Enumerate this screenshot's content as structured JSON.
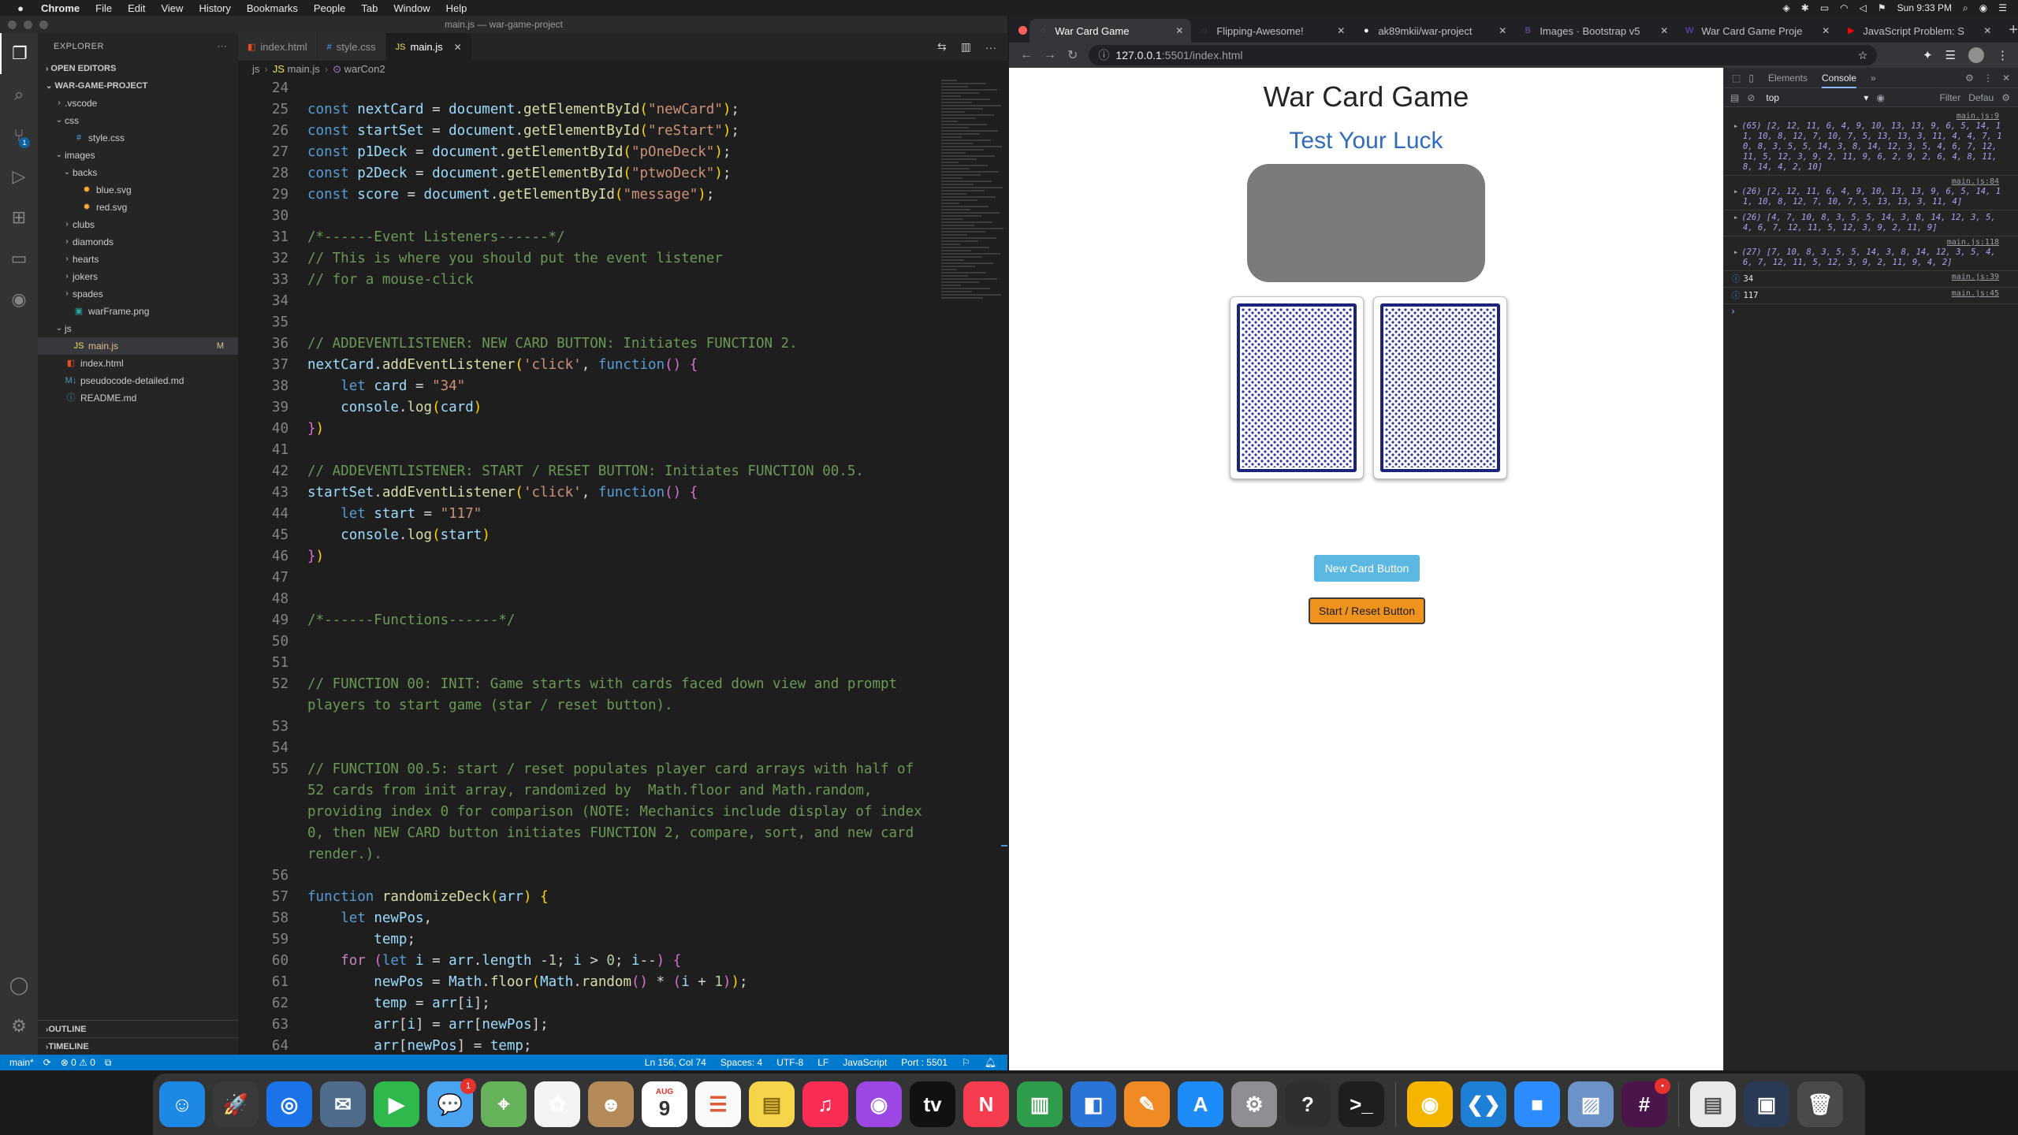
{
  "menubar": {
    "app": "Chrome",
    "items": [
      "File",
      "Edit",
      "View",
      "History",
      "Bookmarks",
      "People",
      "Tab",
      "Window",
      "Help"
    ],
    "clock": "Sun 9:33 PM"
  },
  "vscode": {
    "window_title": "main.js — war-game-project",
    "explorer": {
      "title": "EXPLORER",
      "open_editors": "OPEN EDITORS",
      "project": "WAR-GAME-PROJECT",
      "tree": [
        {
          "name": ".vscode",
          "type": "folder",
          "depth": 1,
          "open": false
        },
        {
          "name": "css",
          "type": "folder",
          "depth": 1,
          "open": true
        },
        {
          "name": "style.css",
          "type": "css",
          "depth": 2
        },
        {
          "name": "images",
          "type": "folder",
          "depth": 1,
          "open": true
        },
        {
          "name": "backs",
          "type": "folder",
          "depth": 2,
          "open": true
        },
        {
          "name": "blue.svg",
          "type": "svg",
          "depth": 3
        },
        {
          "name": "red.svg",
          "type": "svg",
          "depth": 3
        },
        {
          "name": "clubs",
          "type": "folder",
          "depth": 2,
          "open": false
        },
        {
          "name": "diamonds",
          "type": "folder",
          "depth": 2,
          "open": false
        },
        {
          "name": "hearts",
          "type": "folder",
          "depth": 2,
          "open": false
        },
        {
          "name": "jokers",
          "type": "folder",
          "depth": 2,
          "open": false
        },
        {
          "name": "spades",
          "type": "folder",
          "depth": 2,
          "open": false
        },
        {
          "name": "warFrame.png",
          "type": "png",
          "depth": 2
        },
        {
          "name": "js",
          "type": "folder",
          "depth": 1,
          "open": true
        },
        {
          "name": "main.js",
          "type": "js",
          "depth": 2,
          "selected": true,
          "modified": "M"
        },
        {
          "name": "index.html",
          "type": "html",
          "depth": 1
        },
        {
          "name": "pseudocode-detailed.md",
          "type": "md",
          "depth": 1
        },
        {
          "name": "README.md",
          "type": "info",
          "depth": 1
        }
      ],
      "outline": "OUTLINE",
      "timeline": "TIMELINE"
    },
    "tabs": [
      {
        "label": "index.html",
        "icon": "html-icon",
        "active": false
      },
      {
        "label": "style.css",
        "icon": "css-icon",
        "active": false
      },
      {
        "label": "main.js",
        "icon": "js-icon",
        "active": true
      }
    ],
    "breadcrumb": [
      "js",
      "main.js",
      "warCon2"
    ],
    "code_lines": [
      {
        "n": "24",
        "html": ""
      },
      {
        "n": "25",
        "html": "<span class='kw'>const</span> <span class='var'>nextCard</span> = <span class='var'>document</span>.<span class='fn'>getElementById</span><span class='brk'>(</span><span class='str'>\"newCard\"</span><span class='brk'>)</span>;"
      },
      {
        "n": "26",
        "html": "<span class='kw'>const</span> <span class='var'>startSet</span> = <span class='var'>document</span>.<span class='fn'>getElementById</span><span class='brk'>(</span><span class='str'>\"reStart\"</span><span class='brk'>)</span>;"
      },
      {
        "n": "27",
        "html": "<span class='kw'>const</span> <span class='var'>p1Deck</span> = <span class='var'>document</span>.<span class='fn'>getElementById</span><span class='brk'>(</span><span class='str'>\"pOneDeck\"</span><span class='brk'>)</span>;"
      },
      {
        "n": "28",
        "html": "<span class='kw'>const</span> <span class='var'>p2Deck</span> = <span class='var'>document</span>.<span class='fn'>getElementById</span><span class='brk'>(</span><span class='str'>\"ptwoDeck\"</span><span class='brk'>)</span>;"
      },
      {
        "n": "29",
        "html": "<span class='kw'>const</span> <span class='var'>score</span> = <span class='var'>document</span>.<span class='fn'>getElementById</span><span class='brk'>(</span><span class='str'>\"message\"</span><span class='brk'>)</span>;"
      },
      {
        "n": "30",
        "html": ""
      },
      {
        "n": "31",
        "html": "<span class='cmt'>/*------Event Listeners------*/</span>"
      },
      {
        "n": "32",
        "html": "<span class='cmt'>// This is where you should put the event listener</span>"
      },
      {
        "n": "33",
        "html": "<span class='cmt'>// for a mouse-click</span>"
      },
      {
        "n": "34",
        "html": ""
      },
      {
        "n": "35",
        "html": ""
      },
      {
        "n": "36",
        "html": "<span class='cmt'>// ADDEVENTLISTENER: NEW CARD BUTTON: Initiates FUNCTION 2.</span>"
      },
      {
        "n": "37",
        "html": "<span class='var'>nextCard</span>.<span class='fn'>addEventListener</span><span class='brk'>(</span><span class='str'>'click'</span>, <span class='kw'>function</span><span class='brk2'>()</span> <span class='brk2'>{</span>"
      },
      {
        "n": "38",
        "html": "    <span class='kw'>let</span> <span class='var'>card</span> = <span class='str'>\"34\"</span>"
      },
      {
        "n": "39",
        "html": "    <span class='var'>console</span>.<span class='fn'>log</span><span class='brk'>(</span><span class='var'>card</span><span class='brk'>)</span>"
      },
      {
        "n": "40",
        "html": "<span class='brk2'>}</span><span class='brk'>)</span>"
      },
      {
        "n": "41",
        "html": ""
      },
      {
        "n": "42",
        "html": "<span class='cmt'>// ADDEVENTLISTENER: START / RESET BUTTON: Initiates FUNCTION 00.5.</span>"
      },
      {
        "n": "43",
        "html": "<span class='var'>startSet</span>.<span class='fn'>addEventListener</span><span class='brk'>(</span><span class='str'>'click'</span>, <span class='kw'>function</span><span class='brk2'>()</span> <span class='brk2'>{</span>"
      },
      {
        "n": "44",
        "html": "    <span class='kw'>let</span> <span class='var'>start</span> = <span class='str'>\"117\"</span>"
      },
      {
        "n": "45",
        "html": "    <span class='var'>console</span>.<span class='fn'>log</span><span class='brk'>(</span><span class='var'>start</span><span class='brk'>)</span>"
      },
      {
        "n": "46",
        "html": "<span class='brk2'>}</span><span class='brk'>)</span>"
      },
      {
        "n": "47",
        "html": ""
      },
      {
        "n": "48",
        "html": ""
      },
      {
        "n": "49",
        "html": "<span class='cmt'>/*------Functions------*/</span>"
      },
      {
        "n": "50",
        "html": ""
      },
      {
        "n": "51",
        "html": ""
      },
      {
        "n": "52",
        "html": "<span class='cmt'>// FUNCTION 00: INIT: Game starts with cards faced down view and prompt players to start game (star / reset button).</span>",
        "wrap": 2
      },
      {
        "n": "53",
        "html": ""
      },
      {
        "n": "54",
        "html": ""
      },
      {
        "n": "55",
        "html": "<span class='cmt'>// FUNCTION 00.5: start / reset populates player card arrays with half of 52 cards from init array, randomized by  Math.floor and Math.random, providing index 0 for comparison (NOTE: Mechanics include display of index 0, then NEW CARD button initiates FUNCTION 2, compare, sort, and new card render.).</span>",
        "wrap": 5
      },
      {
        "n": "56",
        "html": ""
      },
      {
        "n": "57",
        "html": "<span class='kw'>function</span> <span class='fn'>randomizeDeck</span><span class='brk'>(</span><span class='var'>arr</span><span class='brk'>)</span> <span class='brk'>{</span>"
      },
      {
        "n": "58",
        "html": "    <span class='kw'>let</span> <span class='var'>newPos</span>,"
      },
      {
        "n": "59",
        "html": "        <span class='var'>temp</span>;"
      },
      {
        "n": "60",
        "html": "    <span class='kw2'>for</span> <span class='brk2'>(</span><span class='kw'>let</span> <span class='var'>i</span> = <span class='var'>arr</span>.<span class='var'>length</span> -<span class='num'>1</span>; <span class='var'>i</span> &gt; <span class='num'>0</span>; <span class='var'>i</span>--<span class='brk2'>)</span> <span class='brk2'>{</span>"
      },
      {
        "n": "61",
        "html": "        <span class='var'>newPos</span> = <span class='var'>Math</span>.<span class='fn'>floor</span><span class='brk'>(</span><span class='var'>Math</span>.<span class='fn'>random</span><span class='brk2'>()</span> * <span class='brk2'>(</span><span class='var'>i</span> + <span class='num'>1</span><span class='brk2'>)</span><span class='brk'>)</span>;"
      },
      {
        "n": "62",
        "html": "        <span class='var'>temp</span> = <span class='var'>arr</span>[<span class='var'>i</span>];"
      },
      {
        "n": "63",
        "html": "        <span class='var'>arr</span>[<span class='var'>i</span>] = <span class='var'>arr</span>[<span class='var'>newPos</span>];"
      },
      {
        "n": "64",
        "html": "        <span class='var'>arr</span>[<span class='var'>newPos</span>] = <span class='var'>temp</span>;"
      }
    ],
    "statusbar": {
      "branch": "main*",
      "problems": "⊗ 0 ⚠ 0",
      "position": "Ln 156, Col 74",
      "spaces": "Spaces: 4",
      "encoding": "UTF-8",
      "eol": "LF",
      "language": "JavaScript",
      "port": "Port : 5501"
    }
  },
  "chrome": {
    "tabs": [
      {
        "label": "War Card Game",
        "active": true,
        "favicon": "globe-icon",
        "color": "#5f6368"
      },
      {
        "label": "Flipping-Awesome!",
        "active": false,
        "favicon": "globe-icon",
        "color": "#5f6368"
      },
      {
        "label": "ak89mkii/war-project",
        "active": false,
        "favicon": "github-icon",
        "color": "#ffffff"
      },
      {
        "label": "Images · Bootstrap v5",
        "active": false,
        "favicon": "bootstrap-icon",
        "color": "#7952b3"
      },
      {
        "label": "War Card Game Proje",
        "active": false,
        "favicon": "w-icon",
        "color": "#6b4bd6"
      },
      {
        "label": "JavaScript Problem: S",
        "active": false,
        "favicon": "youtube-icon",
        "color": "#ff0000"
      }
    ],
    "url_host": "127.0.0.1",
    "url_rest": ":5501/index.html",
    "page": {
      "title": "War Card Game",
      "subtitle": "Test Your Luck",
      "new_card_button": "New Card Button",
      "reset_button": "Start / Reset Button"
    },
    "devtools": {
      "tabs": [
        "Elements",
        "Console"
      ],
      "active_tab": "Console",
      "context": "top",
      "filter_placeholder": "Filter",
      "levels": "Defau",
      "entries": [
        {
          "src": "main.js:9",
          "text": "(65) [2, 12, 11, 6, 4, 9, 10, 13, 13, 9, 6, 5, 14, 11, 10, 8, 12, 7, 10, 7, 5, 13, 13, 3, 11, 4, 4, 7, 10, 8, 3, 5, 5, 14, 3, 8, 14, 12, 3, 5, 4, 6, 7, 12, 11, 5, 12, 3, 9, 2, 11, 9, 6, 2, 9, 2, 6, 4, 8, 11, 8, 14, 4, 2, 10]"
        },
        {
          "src": "main.js:84",
          "text": "(26) [2, 12, 11, 6, 4, 9, 10, 13, 13, 9, 6, 5, 14, 11, 10, 8, 12, 7, 10, 7, 5, 13, 13, 3, 11, 4]"
        },
        {
          "src": "",
          "text": "(26) [4, 7, 10, 8, 3, 5, 5, 14, 3, 8, 14, 12, 3, 5, 4, 6, 7, 12, 11, 5, 12, 3, 9, 2, 11, 9]"
        },
        {
          "src": "main.js:118",
          "text": "(27) [7, 10, 8, 3, 5, 5, 14, 3, 8, 14, 12, 3, 5, 4, 6, 7, 12, 11, 5, 12, 3, 9, 2, 11, 9, 4, 2]"
        },
        {
          "src": "main.js:39",
          "text": "34",
          "plain": true
        },
        {
          "src": "main.js:45",
          "text": "117",
          "plain": true
        }
      ]
    }
  },
  "dock": [
    {
      "name": "finder",
      "glyph": "☺",
      "bg": "#1e88e5"
    },
    {
      "name": "launchpad",
      "glyph": "🚀",
      "bg": "#3a3a3c"
    },
    {
      "name": "safari",
      "glyph": "◎",
      "bg": "#1a73e8"
    },
    {
      "name": "mail-bird",
      "glyph": "✉",
      "bg": "#506c8c"
    },
    {
      "name": "facetime",
      "glyph": "▶",
      "bg": "#2fb84b"
    },
    {
      "name": "messages",
      "glyph": "💬",
      "bg": "#4aa3f0",
      "badge": "1"
    },
    {
      "name": "maps",
      "glyph": "⌖",
      "bg": "#67b35b"
    },
    {
      "name": "photos",
      "glyph": "✿",
      "bg": "#f4f4f4"
    },
    {
      "name": "contacts",
      "glyph": "☻",
      "bg": "#b58a5a"
    },
    {
      "name": "calendar",
      "glyph": "9",
      "bg": "#ffffff",
      "fg": "#333333",
      "top": "AUG"
    },
    {
      "name": "reminders",
      "glyph": "☰",
      "bg": "#fafafa",
      "fg": "#e15b3a"
    },
    {
      "name": "notes",
      "glyph": "▤",
      "bg": "#f7d54a",
      "fg": "#8a6d14"
    },
    {
      "name": "music",
      "glyph": "♫",
      "bg": "#fa2d55"
    },
    {
      "name": "podcasts",
      "glyph": "◉",
      "bg": "#9c47e3"
    },
    {
      "name": "tv",
      "glyph": "tv",
      "bg": "#111111"
    },
    {
      "name": "news",
      "glyph": "N",
      "bg": "#f53d4f"
    },
    {
      "name": "numbers",
      "glyph": "▥",
      "bg": "#2e9c4a"
    },
    {
      "name": "keynote",
      "glyph": "◧",
      "bg": "#2a73d7"
    },
    {
      "name": "pages",
      "glyph": "✎",
      "bg": "#f08a24"
    },
    {
      "name": "app-store",
      "glyph": "A",
      "bg": "#1d8cf8"
    },
    {
      "name": "system-preferences",
      "glyph": "⚙",
      "bg": "#8e8e93"
    },
    {
      "name": "help",
      "glyph": "?",
      "bg": "#2f2f31"
    },
    {
      "name": "terminal",
      "glyph": "&gt;_",
      "bg": "#1e1e1e"
    },
    {
      "name": "chrome",
      "glyph": "◉",
      "bg": "#f4b400"
    },
    {
      "name": "vscode",
      "glyph": "❮❯",
      "bg": "#1e7fd6"
    },
    {
      "name": "zoom",
      "glyph": "■",
      "bg": "#2d8cff"
    },
    {
      "name": "preview",
      "glyph": "▨",
      "bg": "#6b93c7"
    },
    {
      "name": "slack",
      "glyph": "#",
      "bg": "#4a154b",
      "badge": "•"
    },
    {
      "name": "doc-stack",
      "glyph": "▤",
      "bg": "#e9e9e9",
      "fg": "#555555"
    },
    {
      "name": "screenshot",
      "glyph": "▣",
      "bg": "#2a3a55"
    },
    {
      "name": "trash",
      "glyph": "🗑",
      "bg": "#4a4a4c"
    }
  ]
}
